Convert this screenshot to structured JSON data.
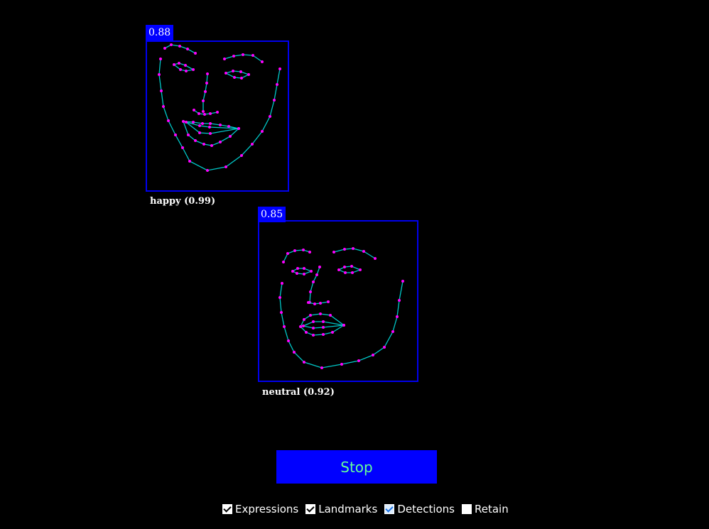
{
  "detections": [
    {
      "score": "0.88",
      "expression": "happy (0.99)"
    },
    {
      "score": "0.85",
      "expression": "neutral (0.92)"
    }
  ],
  "controls": {
    "stop_label": "Stop",
    "options": [
      {
        "label": "Expressions",
        "checked": true
      },
      {
        "label": "Landmarks",
        "checked": true
      },
      {
        "label": "Detections",
        "checked": true
      },
      {
        "label": "Retain",
        "checked": false
      }
    ]
  },
  "colors": {
    "box": "#0000ee",
    "landmark_line": "#00c8c8",
    "landmark_point": "#ff00ff",
    "button_text": "#66ff99"
  }
}
